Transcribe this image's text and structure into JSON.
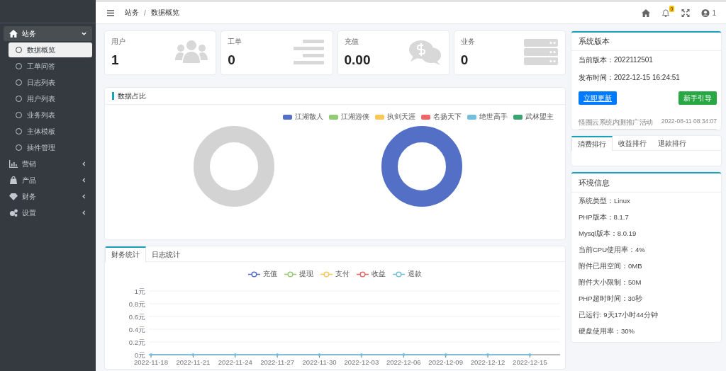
{
  "header": {
    "breadcrumb": [
      "站务",
      "数据概览"
    ],
    "breadcrumb_separator": "/",
    "notification_count": "0",
    "user_label": "1"
  },
  "sidebar": {
    "items": [
      {
        "label": "站务",
        "expanded": true,
        "children": [
          {
            "label": "数据概览",
            "selected": true
          },
          {
            "label": "工单问答",
            "selected": false
          },
          {
            "label": "日志列表",
            "selected": false
          },
          {
            "label": "用户列表",
            "selected": false
          },
          {
            "label": "业务列表",
            "selected": false
          },
          {
            "label": "主体模板",
            "selected": false
          },
          {
            "label": "插件管理",
            "selected": false
          }
        ]
      },
      {
        "label": "营销",
        "expanded": false
      },
      {
        "label": "产品",
        "expanded": false
      },
      {
        "label": "财务",
        "expanded": false
      },
      {
        "label": "设置",
        "expanded": false
      }
    ]
  },
  "stats": [
    {
      "label": "用户",
      "value": "1"
    },
    {
      "label": "工单",
      "value": "0"
    },
    {
      "label": "充值",
      "value": "0.00"
    },
    {
      "label": "业务",
      "value": "0"
    }
  ],
  "share_panel": {
    "title": "数据占比",
    "legend": [
      {
        "label": "江湖散人",
        "color": "#5470c6"
      },
      {
        "label": "江湖游侠",
        "color": "#91cc75"
      },
      {
        "label": "执剑天涯",
        "color": "#fac858"
      },
      {
        "label": "名扬天下",
        "color": "#ee6666"
      },
      {
        "label": "绝世高手",
        "color": "#73c0de"
      },
      {
        "label": "武林盟主",
        "color": "#3ba272"
      }
    ],
    "donuts": [
      {
        "kind": "empty"
      },
      {
        "kind": "single"
      }
    ]
  },
  "stats_tabs": {
    "tabs": [
      {
        "label": "财务统计",
        "selected": true
      },
      {
        "label": "日志统计",
        "selected": false
      }
    ],
    "chart_data": {
      "type": "line",
      "categories": [
        "2022-11-18",
        "2022-11-21",
        "2022-11-24",
        "2022-11-27",
        "2022-11-30",
        "2022-12-03",
        "2022-12-06",
        "2022-12-09",
        "2022-12-12",
        "2022-12-15"
      ],
      "series": [
        {
          "name": "充值",
          "color": "#5470c6",
          "values": [
            null,
            null,
            null,
            null,
            null,
            null,
            null,
            null,
            null,
            null
          ]
        },
        {
          "name": "提现",
          "color": "#91cc75",
          "values": [
            null,
            null,
            null,
            null,
            null,
            null,
            null,
            null,
            null,
            null
          ]
        },
        {
          "name": "支付",
          "color": "#fac858",
          "values": [
            null,
            null,
            null,
            null,
            null,
            null,
            null,
            null,
            null,
            null
          ]
        },
        {
          "name": "收益",
          "color": "#ee6666",
          "values": [
            null,
            null,
            null,
            null,
            null,
            null,
            null,
            null,
            null,
            null
          ]
        },
        {
          "name": "退款",
          "color": "#73c0de",
          "values": [
            0,
            0,
            0,
            0,
            0,
            0,
            0,
            0,
            0,
            0
          ]
        }
      ],
      "grid": true,
      "ylim": [
        0,
        1
      ],
      "yticks": [
        {
          "value": 0,
          "label": "0元"
        },
        {
          "value": 0.2,
          "label": "0.2元"
        },
        {
          "value": 0.4,
          "label": "0.4元"
        },
        {
          "value": 0.6,
          "label": "0.6元"
        },
        {
          "value": 0.8,
          "label": "0.8元"
        },
        {
          "value": 1,
          "label": "1元"
        }
      ]
    }
  },
  "version_panel": {
    "title": "系统版本",
    "lines": [
      "当前版本：2022112501",
      "发布时间：2022-12-15 16:24:51"
    ],
    "buttons": [
      {
        "label": "立即更新",
        "kind": "primary"
      },
      {
        "label": "新手引导",
        "kind": "success"
      }
    ],
    "notice": {
      "title": "怪圈云系统内测推广活动",
      "time": "2022-08-11 08:34:07"
    }
  },
  "ranking_tabs": [
    {
      "label": "消费排行",
      "selected": true
    },
    {
      "label": "收益排行",
      "selected": false
    },
    {
      "label": "退款排行",
      "selected": false
    }
  ],
  "env_panel": {
    "title": "环境信息",
    "lines": [
      "系统类型：Linux",
      "PHP版本：8.1.7",
      "Mysql版本：8.0.19",
      "当前CPU使用率：4%",
      "附件已用空间：0MB",
      "附件大小限制：50M",
      "PHP超时时间：30秒",
      "已运行: 9天17小时44分钟",
      "硬盘使用率：30%"
    ]
  }
}
